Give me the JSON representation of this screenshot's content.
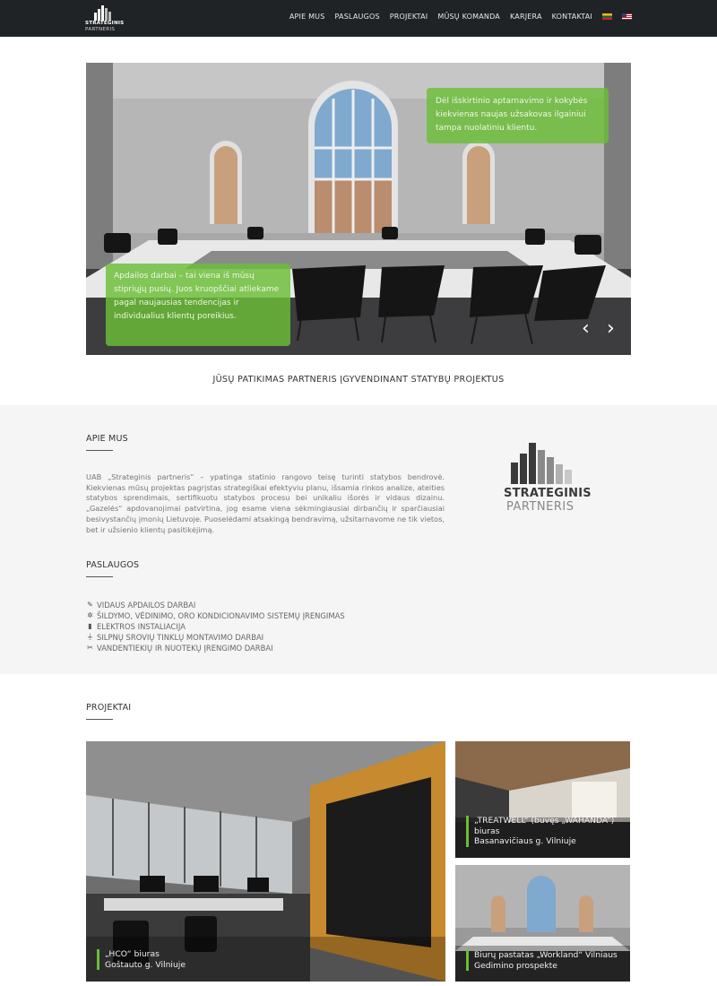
{
  "brand": {
    "logo_line1": "STRATEGINIS",
    "logo_line2": "PARTNERIS"
  },
  "nav": {
    "items": [
      {
        "label": "APIE MUS"
      },
      {
        "label": "PASLAUGOS"
      },
      {
        "label": "PROJEKTAI"
      },
      {
        "label": "MŪSŲ KOMANDA"
      },
      {
        "label": "KARJERA"
      },
      {
        "label": "KONTAKTAI"
      }
    ],
    "flags": [
      "flag-lt-icon",
      "flag-us-icon"
    ]
  },
  "hero": {
    "caption_top": "Dėl išskirtinio aptarnavimo ir kokybės kiekvienas naujas užsakovas ilgainiui tampa nuolatiniu klientu.",
    "caption_bottom": "Apdailos darbai – tai viena iš mūsų stipriųjų pusių. Juos kruopščiai atliekame pagal naujausias tendencijas ir individualius klientų poreikius.",
    "prev_icon": "‹",
    "next_icon": "›"
  },
  "tagline": "JŪSŲ PATIKIMAS PARTNERIS ĮGYVENDINANT STATYBŲ PROJEKTUS",
  "about": {
    "title": "APIE MUS",
    "text": "UAB „Strateginis partneris“ – ypatinga statinio rangovo teisę turinti statybos bendrovė. Kiekvienas mūsų projektas pagrįstas strategiškai efektyviu planu, išsamia rinkos analize, ateities statybos sprendimais, sertifikuotu statybos procesu bei unikaliu išorės ir vidaus dizainu. „Gazelės“ apdovanojimai patvirtina, jog esame viena sėkmingiausiai dirbančių ir sparčiausiai besivystančių įmonių Lietuvoje. Puoselėdami atsakingą bendravimą, užsitarnavome ne tik vietos, bet ir užsienio klientų pasitikėjimą.",
    "logo_line1": "STRATEGINIS",
    "logo_line2": "PARTNERIS"
  },
  "services": {
    "title": "PASLAUGOS",
    "items": [
      {
        "label": "VIDAUS APDAILOS DARBAI",
        "icon": "brush-icon"
      },
      {
        "label": "ŠILDYMO, VĖDINIMO, ORO KONDICIONAVIMO SISTEMŲ ĮRENGIMAS",
        "icon": "fan-icon"
      },
      {
        "label": "ELEKTROS INSTALIACIJA",
        "icon": "battery-icon"
      },
      {
        "label": "SILPNŲ SROVIŲ TINKLŲ MONTAVIMO DARBAI",
        "icon": "plug-icon"
      },
      {
        "label": "VANDENTIEKIŲ IR NUOTEKŲ ĮRENGIMO DARBAI",
        "icon": "wrench-icon"
      }
    ]
  },
  "projects": {
    "title": "PROJEKTAI",
    "items": [
      {
        "line1": "„HCO“ biuras",
        "line2": "Goštauto g. Vilniuje"
      },
      {
        "line1": "„TREATWELL“ (buvęs „WAHANDA“)",
        "line2": "biuras",
        "line3": "Basanavičiaus g. Vilniuje"
      },
      {
        "line1": "Biurų pastatas „Workland“ Vilniaus",
        "line2": "Gedimino prospekte"
      }
    ]
  },
  "colors": {
    "accent": "#6abe36",
    "nav_bg": "#1f2326",
    "section_bg": "#f5f5f5"
  }
}
